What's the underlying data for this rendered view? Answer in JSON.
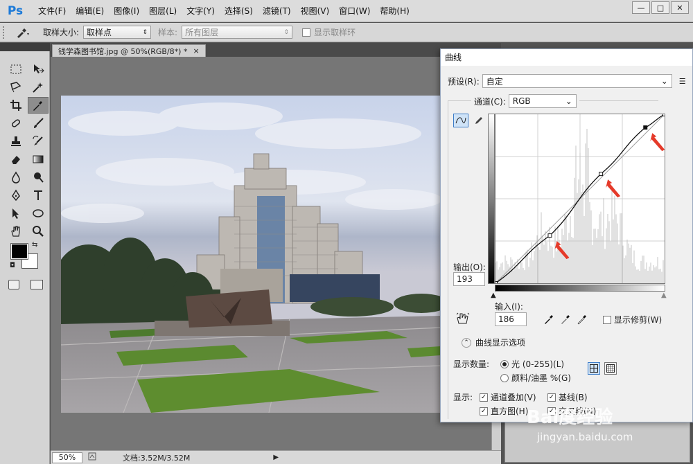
{
  "app": {
    "logo": "Ps"
  },
  "menubar": {
    "items": [
      "文件(F)",
      "编辑(E)",
      "图像(I)",
      "图层(L)",
      "文字(Y)",
      "选择(S)",
      "滤镜(T)",
      "视图(V)",
      "窗口(W)",
      "帮助(H)"
    ],
    "window_controls": [
      "—",
      "□",
      "✕"
    ]
  },
  "options_bar": {
    "sample_size_label": "取样大小:",
    "sample_size_value": "取样点",
    "sample_label": "样本:",
    "sample_value": "所有图层",
    "show_ring_label": "显示取样环"
  },
  "document": {
    "tab_title": "钱学森图书馆.jpg @ 50%(RGB/8*) *",
    "tab_close": "×",
    "zoom": "50%",
    "doc_info": "文档:3.52M/3.52M",
    "status_arrow": "▶"
  },
  "toolbox": {
    "swap": "⇆",
    "reset": "◘"
  },
  "curves_dialog": {
    "title": "曲线",
    "preset_label": "预设(R):",
    "preset_value": "自定",
    "channel_label": "通道(C):",
    "channel_value": "RGB",
    "output_label": "输出(O):",
    "output_value": "193",
    "input_label": "输入(I):",
    "input_value": "186",
    "show_clipping_label": "显示修剪(W)",
    "display_options_label": "曲线显示选项",
    "show_amount_label": "显示数量:",
    "light_option": "光 (0-255)(L)",
    "pigment_option": "颜料/油墨 %(G)",
    "show_label": "显示:",
    "channel_overlay": "通道叠加(V)",
    "baseline": "基线(B)",
    "histogram": "直方图(H)",
    "intersection": "交叉线(N)",
    "curve_points": [
      [
        0,
        0
      ],
      [
        82,
        72
      ],
      [
        159,
        165
      ],
      [
        226,
        235
      ],
      [
        255,
        255
      ]
    ],
    "highlight_points": [
      [
        82,
        72
      ],
      [
        159,
        165
      ],
      [
        226,
        235
      ]
    ]
  },
  "watermark": {
    "text": "Bai度经验",
    "url": "jingyan.baidu.com"
  }
}
